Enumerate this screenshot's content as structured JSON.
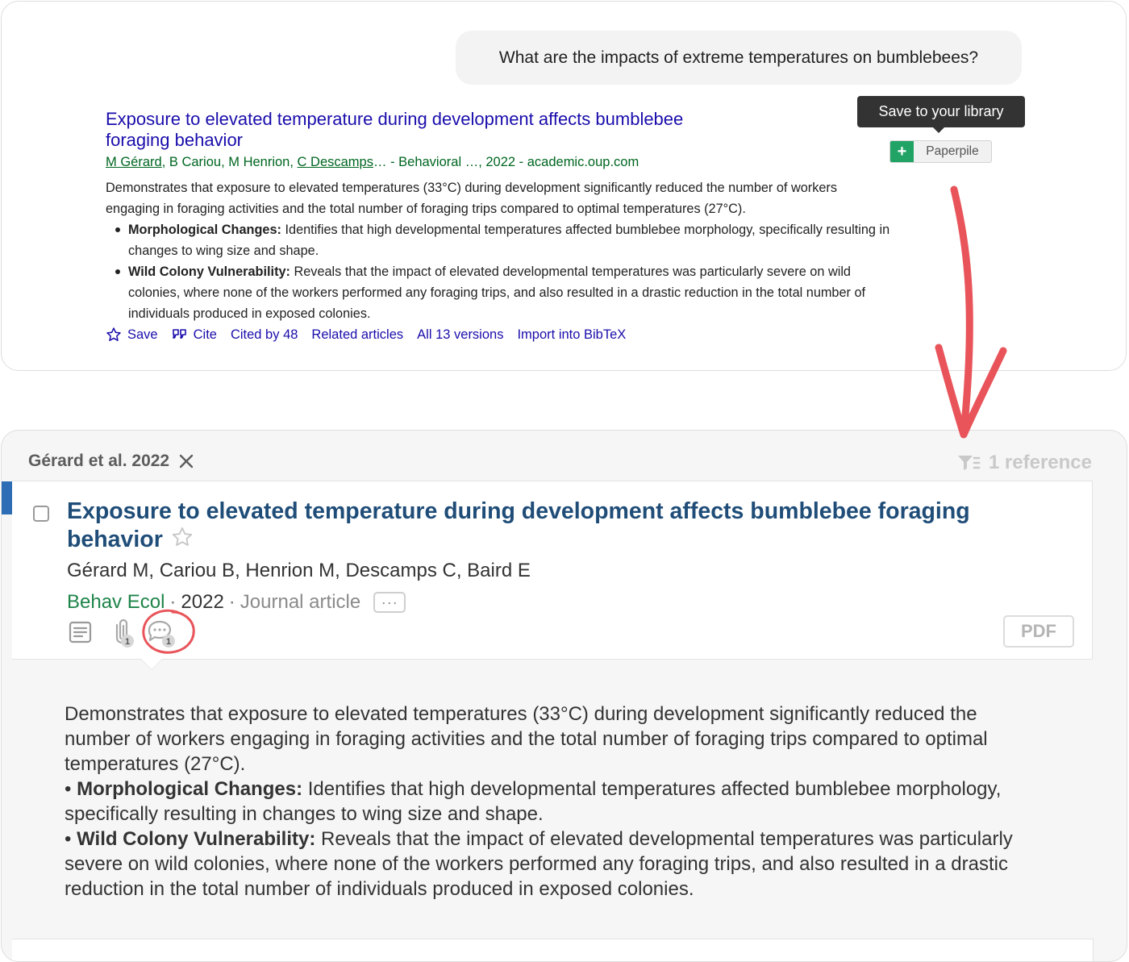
{
  "search_result": {
    "query": "What are the impacts of extreme temperatures on bumblebees?",
    "title_line1": "Exposure to elevated temperature during development affects bumblebee",
    "title_line2": "foraging behavior",
    "authors": [
      "M Gérard",
      "B Cariou",
      "M Henrion",
      "C Descamps"
    ],
    "author_sep": ", ",
    "meta_tail": "… - Behavioral …, 2022 - academic.oup.com",
    "summary": "Demonstrates that exposure to elevated temperatures (33°C) during development significantly reduced the number of workers engaging in foraging activities and the total number of foraging trips compared to optimal temperatures (27°C).",
    "bullets": [
      {
        "label": "Morphological Changes:",
        "text": " Identifies that high developmental temperatures affected bumblebee morphology, specifically resulting in changes to wing size and shape."
      },
      {
        "label": "Wild Colony Vulnerability:",
        "text": " Reveals that the impact of elevated developmental temperatures was particularly severe on wild colonies, where none of the workers performed any foraging trips, and also resulted in a drastic reduction in the total number of individuals produced in exposed colonies."
      }
    ],
    "actions": {
      "save": "Save",
      "cite": "Cite",
      "cited_by": "Cited by 48",
      "related": "Related articles",
      "versions": "All 13 versions",
      "bibtex": "Import into BibTeX"
    },
    "tooltip": "Save to your library",
    "paperpile_button": "Paperpile",
    "paperpile_plus": "+"
  },
  "library_panel": {
    "tab_label": "Gérard et al. 2022",
    "reference_count": "1 reference",
    "item": {
      "title": "Exposure to elevated temperature during development affects bumblebee foraging behavior",
      "authors": "Gérard M, Cariou B, Henrion M, Descamps C, Baird E",
      "journal": "Behav Ecol",
      "year": "2022",
      "type": "Journal article",
      "meta_sep": "·",
      "more": "···",
      "attachment_count": "1",
      "comment_count": "1",
      "pdf_label": "PDF"
    },
    "note": {
      "summary": "Demonstrates that exposure to elevated temperatures (33°C) during development significantly reduced the number of workers engaging in foraging activities and the total number of foraging trips compared to optimal temperatures (27°C).",
      "bullet_char": "•",
      "bullets": [
        {
          "label": "Morphological Changes:",
          "text": " Identifies that high developmental temperatures affected bumblebee morphology, specifically resulting in changes to wing size and shape."
        },
        {
          "label": "Wild Colony Vulnerability:",
          "text": " Reveals that the impact of elevated developmental temperatures was particularly severe on wild colonies, where none of the workers performed any foraging trips, and also resulted in a drastic reduction in the total number of individuals produced in exposed colonies."
        }
      ]
    }
  },
  "colors": {
    "link": "#1a0dab",
    "green": "#006621",
    "title_blue": "#1f4d78",
    "journal_green": "#1e8449",
    "annotation_red": "#e8545a",
    "paperpile_green": "#21a366"
  }
}
